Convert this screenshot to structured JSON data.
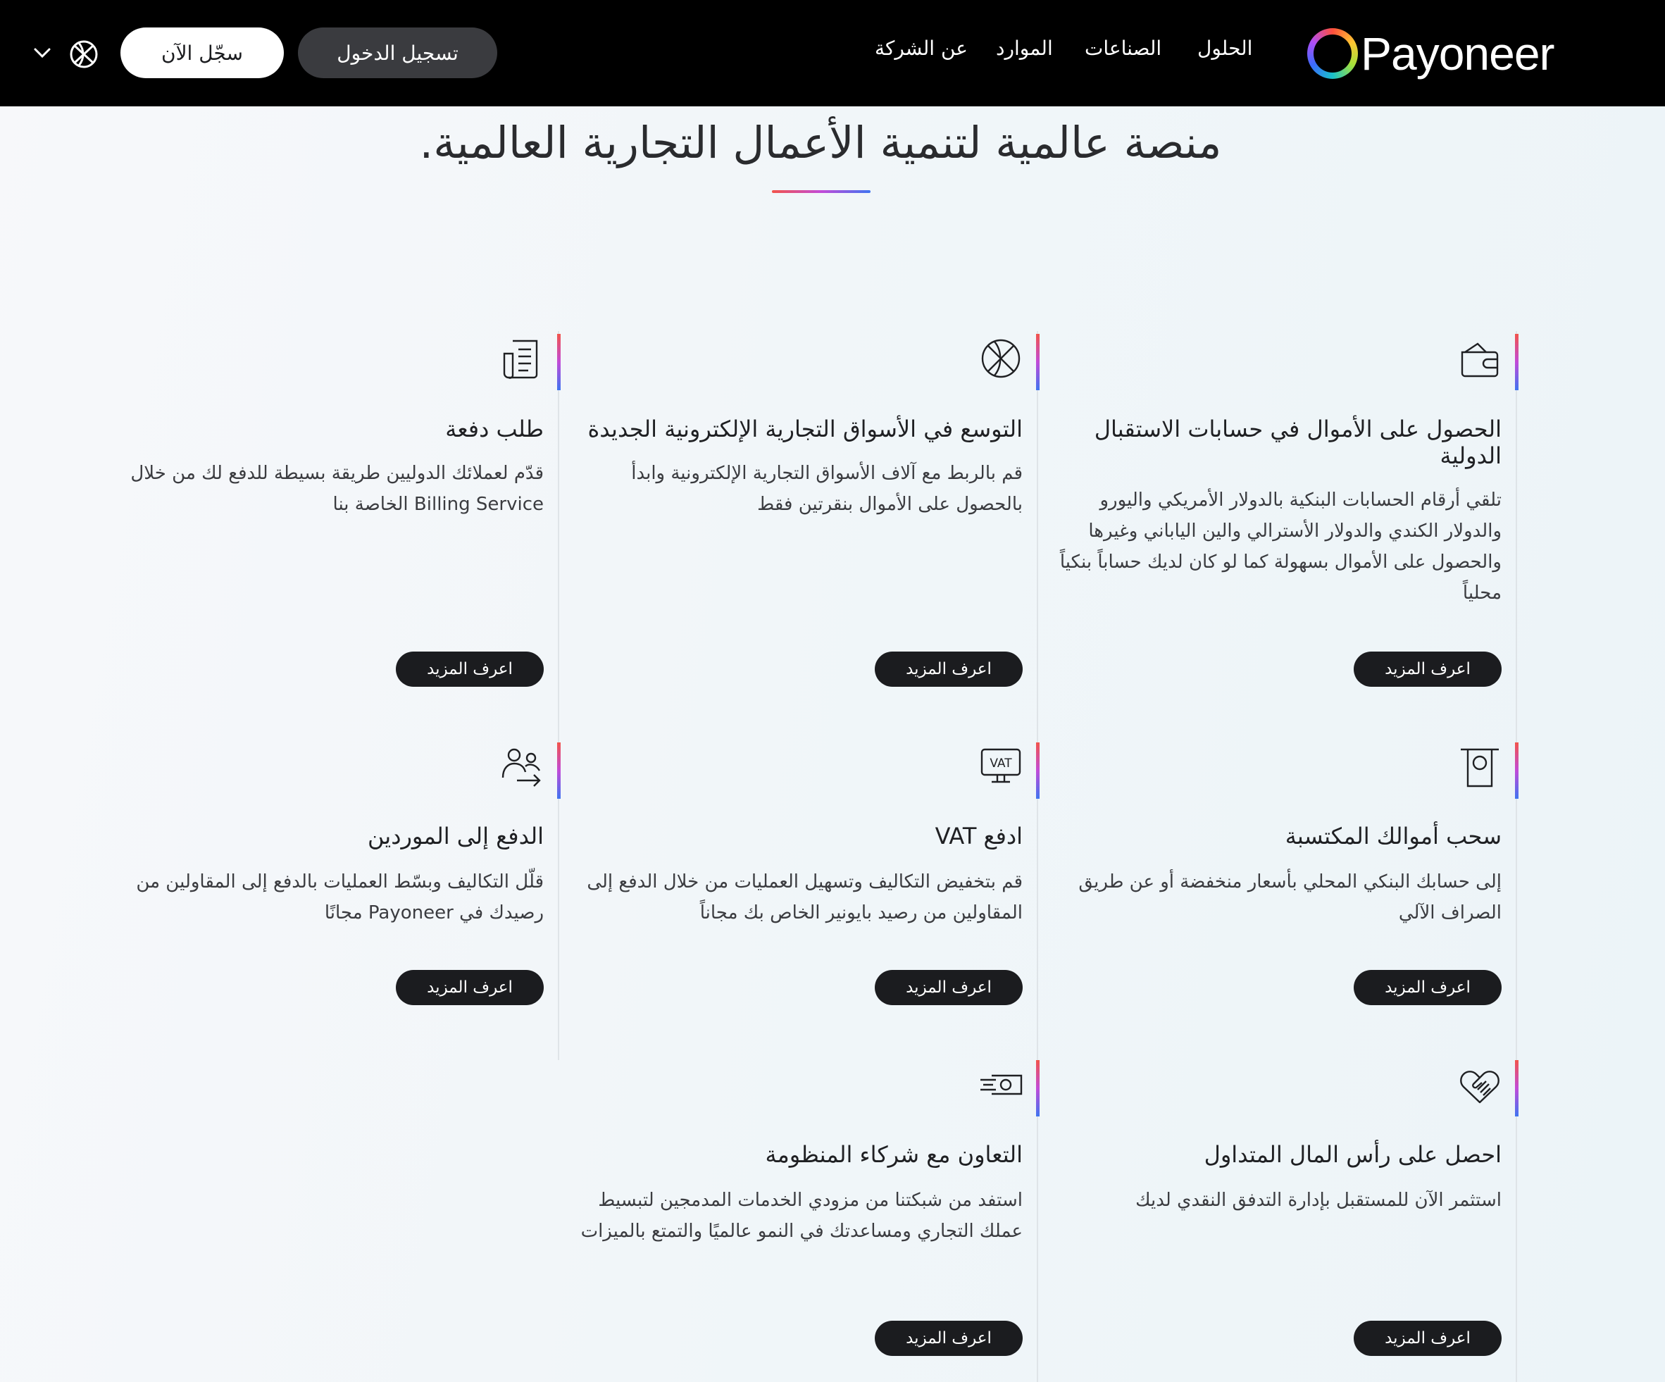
{
  "header": {
    "logo_text": "Payoneer",
    "nav": [
      "الحلول",
      "الصناعات",
      "الموارد",
      "عن الشركة"
    ],
    "login_label": "تسجيل الدخول",
    "signup_label": "سجّل الآن",
    "language_icon": "globe-icon",
    "dropdown_icon": "chevron-down-icon"
  },
  "main": {
    "title": "منصة عالمية لتنمية الأعمال التجارية العالمية.",
    "cards": [
      {
        "icon": "wallet-icon",
        "title": "الحصول على الأموال في حسابات الاستقبال الدولية",
        "description": "تلقي أرقام الحسابات البنكية بالدولار الأمريكي واليورو والدولار الكندي والدولار الأسترالي والين الياباني وغيرها والحصول على الأموال بسهولة كما لو كان لديك حساباً بنكياً محلياً",
        "cta": "اعرف المزيد"
      },
      {
        "icon": "globe-icon",
        "title": "التوسع في الأسواق التجارية الإلكترونية الجديدة",
        "description": "قم بالربط مع آلاف الأسواق التجارية الإلكترونية وابدأ بالحصول على الأموال بنقرتين فقط",
        "cta": "اعرف المزيد"
      },
      {
        "icon": "invoice-icon",
        "title": "طلب دفعة",
        "description": "قدّم لعملائك الدوليين طريقة بسيطة للدفع لك من خلال Billing Service الخاصة بنا",
        "cta": "اعرف المزيد"
      },
      {
        "icon": "atm-withdraw-icon",
        "title": "سحب أموالك المكتسبة",
        "description": "إلى حسابك البنكي المحلي بأسعار منخفضة أو عن طريق الصراف الآلي",
        "cta": "اعرف المزيد"
      },
      {
        "icon": "vat-icon",
        "title": "ادفع VAT",
        "description": "قم بتخفيض التكاليف وتسهيل العمليات من خلال الدفع إلى المقاولين من رصيد بايونير الخاص بك مجاناً",
        "cta": "اعرف المزيد"
      },
      {
        "icon": "pay-suppliers-icon",
        "title": "الدفع إلى الموردين",
        "description": "قلّل التكاليف وبسّط العمليات بالدفع إلى المقاولين من رصيدك في Payoneer مجانًا",
        "cta": "اعرف المزيد"
      },
      {
        "icon": "handshake-icon",
        "title": "احصل على رأس المال المتداول",
        "description": "استثمر الآن للمستقبل بإدارة التدفق النقدي لديك",
        "cta": "اعرف المزيد"
      },
      {
        "icon": "cash-partners-icon",
        "title": "التعاون مع شركاء المنظومة",
        "description": "استفد من شبكتنا من مزودي الخدمات المدمجين لتبسيط عملك التجاري ومساعدتك في النمو عالميًا والتمتع بالميزات",
        "cta": "اعرف المزيد"
      }
    ]
  }
}
